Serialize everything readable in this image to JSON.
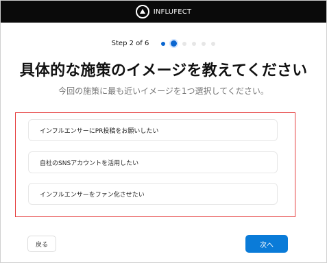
{
  "brand": {
    "name": "INFLUFECT"
  },
  "progress": {
    "text": "Step 2 of 6",
    "current": 2,
    "total": 6
  },
  "title": "具体的な施策のイメージを教えてください",
  "subtitle": "今回の施策に最も近いイメージを1つ選択してください。",
  "options": [
    {
      "label": "インフルエンサーにPR投稿をお願いしたい"
    },
    {
      "label": "自社のSNSアカウントを活用したい"
    },
    {
      "label": "インフルエンサーをファン化させたい"
    }
  ],
  "buttons": {
    "back": "戻る",
    "next": "次へ"
  },
  "colors": {
    "accent": "#0a7bd8",
    "topbar": "#0a0a0a",
    "highlight": "#e53b3b"
  }
}
